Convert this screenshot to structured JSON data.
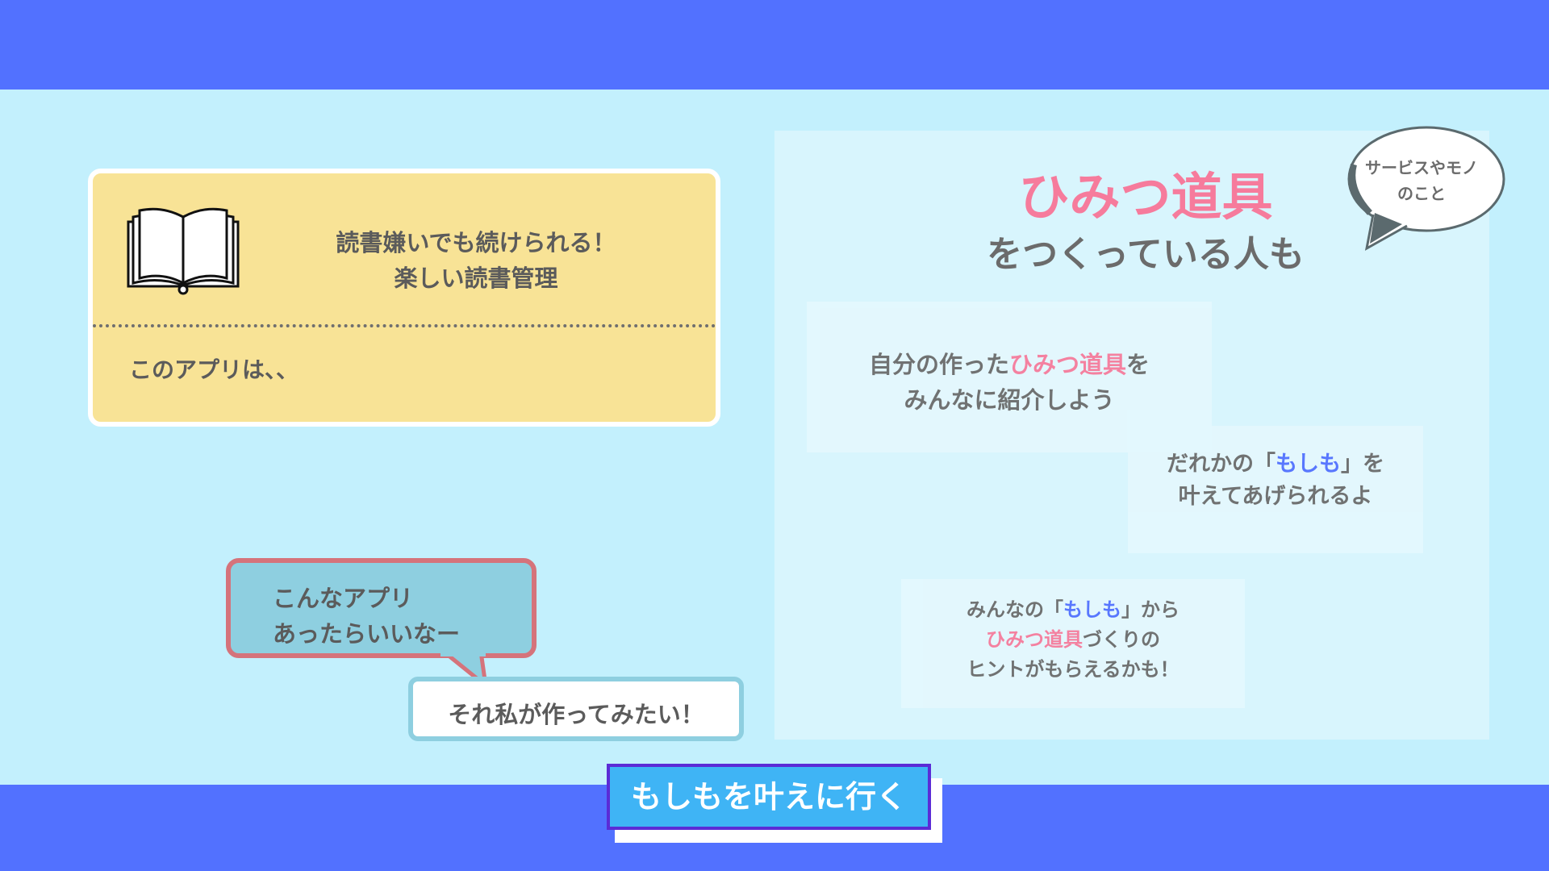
{
  "info_card": {
    "title_line1": "読書嫌いでも続けられる！",
    "title_line2": "楽しい読書管理",
    "body": "このアプリは、、",
    "icon": "open-book-icon"
  },
  "speech": {
    "wish_line1": "こんなアプリ",
    "wish_line2": "あったらいいなー",
    "reply": "それ私が作ってみたい！"
  },
  "cta": {
    "label": "もしもを叶えに行く"
  },
  "right": {
    "headline": "ひみつ道具",
    "subheadline": "をつくっている人も",
    "thought_line1": "サービスやモノ",
    "thought_line2": "のこと",
    "tile1": {
      "prefix": "自分の作った",
      "highlight": "ひみつ道具",
      "suffix": "を",
      "line2": "みんなに紹介しよう"
    },
    "tile2": {
      "prefix": "だれかの「",
      "highlight": "もしも",
      "suffix": "」を",
      "line2": "叶えてあげられるよ"
    },
    "tile3": {
      "line1_prefix": "みんなの「",
      "line1_highlight": "もしも",
      "line1_suffix": "」から",
      "line2_highlight": "ひみつ道具",
      "line2_suffix": "づくりの",
      "line3": "ヒントがもらえるかも！"
    }
  },
  "colors": {
    "band": "#5271ff",
    "background": "#c3f0fd",
    "card": "#f8e396",
    "accent_pink": "#f67b9c",
    "accent_blue": "#5271ff",
    "cta": "#3fb4f5"
  }
}
